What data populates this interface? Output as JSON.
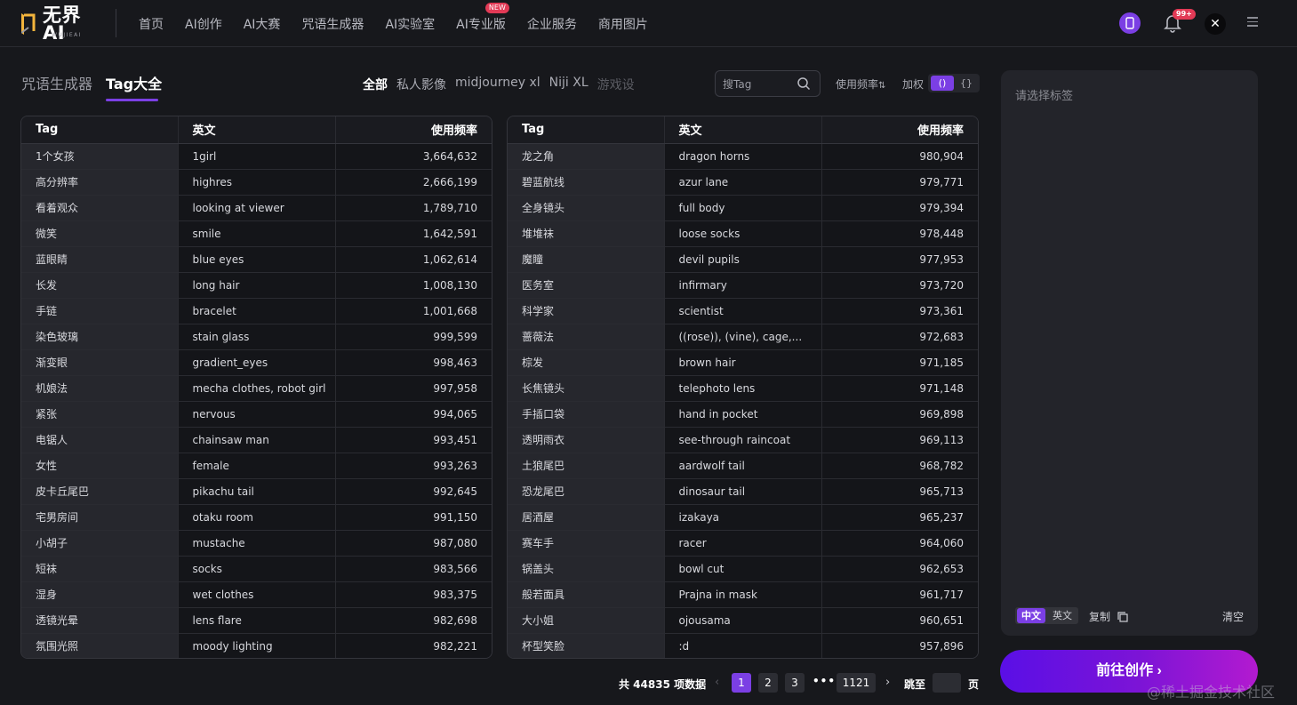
{
  "header": {
    "logo_text": "无界AI",
    "logo_sub": "WUJIEAI",
    "nav": [
      {
        "label": "首页"
      },
      {
        "label": "AI创作"
      },
      {
        "label": "AI大赛"
      },
      {
        "label": "咒语生成器"
      },
      {
        "label": "AI实验室"
      },
      {
        "label": "AI专业版",
        "badge": "NEW"
      },
      {
        "label": "企业服务"
      },
      {
        "label": "商用图片"
      }
    ],
    "notification_count": "99+",
    "avatar_glyph": "✕"
  },
  "tabs": {
    "spell_generator": "咒语生成器",
    "tag_all": "Tag大全"
  },
  "categories": [
    "全部",
    "私人影像",
    "midjourney xl",
    "Niji XL",
    "游戏设"
  ],
  "search": {
    "placeholder": "搜Tag"
  },
  "sort_label": "使用频率",
  "weight": {
    "label": "加权",
    "options": [
      "()",
      "{}"
    ],
    "selected": "()"
  },
  "table_headers": [
    "Tag",
    "英文",
    "使用频率"
  ],
  "left_table": [
    [
      "1个女孩",
      "1girl",
      "3,664,632"
    ],
    [
      "高分辨率",
      "highres",
      "2,666,199"
    ],
    [
      "看着观众",
      "looking at viewer",
      "1,789,710"
    ],
    [
      "微笑",
      "smile",
      "1,642,591"
    ],
    [
      "蓝眼睛",
      "blue eyes",
      "1,062,614"
    ],
    [
      "长发",
      "long hair",
      "1,008,130"
    ],
    [
      "手链",
      "bracelet",
      "1,001,668"
    ],
    [
      "染色玻璃",
      "stain glass",
      "999,599"
    ],
    [
      "渐变眼",
      "gradient_eyes",
      "998,463"
    ],
    [
      "机娘法",
      "mecha clothes, robot girl",
      "997,958"
    ],
    [
      "紧张",
      "nervous",
      "994,065"
    ],
    [
      "电锯人",
      "chainsaw man",
      "993,451"
    ],
    [
      "女性",
      "female",
      "993,263"
    ],
    [
      "皮卡丘尾巴",
      "pikachu tail",
      "992,645"
    ],
    [
      "宅男房间",
      "otaku room",
      "991,150"
    ],
    [
      "小胡子",
      "mustache",
      "987,080"
    ],
    [
      "短袜",
      "socks",
      "983,566"
    ],
    [
      "湿身",
      "wet clothes",
      "983,375"
    ],
    [
      "透镜光晕",
      "lens flare",
      "982,698"
    ],
    [
      "氛围光照",
      "moody lighting",
      "982,221"
    ]
  ],
  "right_table": [
    [
      "龙之角",
      "dragon horns",
      "980,904"
    ],
    [
      "碧蓝航线",
      "azur lane",
      "979,771"
    ],
    [
      "全身镜头",
      "full body",
      "979,394"
    ],
    [
      "堆堆袜",
      "loose socks",
      "978,448"
    ],
    [
      "魔瞳",
      "devil pupils",
      "977,953"
    ],
    [
      "医务室",
      "infirmary",
      "973,720"
    ],
    [
      "科学家",
      "scientist",
      "973,361"
    ],
    [
      "蔷薇法",
      "((rose)), (vine), cage,...",
      "972,683"
    ],
    [
      "棕发",
      "brown hair",
      "971,185"
    ],
    [
      "长焦镜头",
      "telephoto lens",
      "971,148"
    ],
    [
      "手插口袋",
      "hand in pocket",
      "969,898"
    ],
    [
      "透明雨衣",
      "see-through raincoat",
      "969,113"
    ],
    [
      "土狼尾巴",
      "aardwolf tail",
      "968,782"
    ],
    [
      "恐龙尾巴",
      "dinosaur tail",
      "965,713"
    ],
    [
      "居酒屋",
      "izakaya",
      "965,237"
    ],
    [
      "赛车手",
      "racer",
      "964,060"
    ],
    [
      "锅盖头",
      "bowl cut",
      "962,653"
    ],
    [
      "般若面具",
      "Prajna in mask",
      "961,717"
    ],
    [
      "大小姐",
      "ojousama",
      "960,651"
    ],
    [
      "杯型笑脸",
      ":d",
      "957,896"
    ]
  ],
  "pagination": {
    "total_text": "共 44835 项数据",
    "pages": [
      "1",
      "2",
      "3"
    ],
    "current": "1",
    "dots": "•••",
    "last": "1121",
    "jump_label": "跳至",
    "page_suffix": "页"
  },
  "panel": {
    "placeholder": "请选择标签",
    "lang_options": [
      "中文",
      "英文"
    ],
    "lang_selected": "中文",
    "copy_label": "复制",
    "clear_label": "清空",
    "create_label": "前往创作 ›"
  },
  "watermark": "@稀土掘金技术社区",
  "colors": {
    "accent": "#7b3fe4",
    "badge": "#e23a56",
    "bg": "#17181c"
  }
}
